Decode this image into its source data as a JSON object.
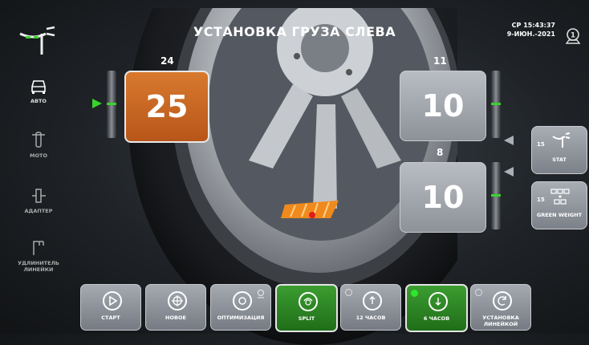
{
  "header": {
    "title": "УСТАНОВКА ГРУЗА СЛЕВА",
    "clock_line1": "СР 15:43:37",
    "clock_line2": "9-ИЮН.-2021"
  },
  "sidebar": {
    "items": [
      {
        "label": "АВТО",
        "icon": "car-icon"
      },
      {
        "label": "МОТО",
        "icon": "motorcycle-icon"
      },
      {
        "label": "АДАПТЕР",
        "icon": "adapter-icon"
      },
      {
        "label": "УДЛИНИТЕЛЬ ЛИНЕЙКИ",
        "line1": "УДЛИНИТЕЛЬ",
        "line2": "ЛИНЕЙКИ",
        "icon": "ruler-extension-icon"
      }
    ]
  },
  "left_plane": {
    "position": "24",
    "weight": "25"
  },
  "right_plane_top": {
    "position": "11",
    "weight": "10"
  },
  "right_plane_bottom": {
    "position": "8",
    "weight": "10"
  },
  "right_buttons": [
    {
      "label": "STAT",
      "badge": "15"
    },
    {
      "label": "GREEN WEIGHT",
      "badge": "15"
    }
  ],
  "toolbar": [
    {
      "label": "СТАРТ",
      "icon": "play-icon",
      "active": false
    },
    {
      "label": "НОВОЕ",
      "icon": "wheel-icon",
      "active": false
    },
    {
      "label": "ОПТИМИЗАЦИЯ",
      "icon": "optimization-icon",
      "active": false
    },
    {
      "label": "SPLIT",
      "icon": "split-icon",
      "active": true
    },
    {
      "label": "12 ЧАСОВ",
      "icon": "clock-12-icon",
      "active": false
    },
    {
      "label": "6 ЧАСОВ",
      "icon": "clock-6-icon",
      "active": true
    },
    {
      "label": "УСТАНОВКА ЛИНЕЙКОЙ",
      "line1": "УСТАНОВКА",
      "line2": "ЛИНЕЙКОЙ",
      "icon": "ruler-mount-icon",
      "active": false
    }
  ],
  "colors": {
    "accent_green": "#39d32e",
    "weight_orange": "#c9662a",
    "panel_gray": "#9ea3aa"
  }
}
